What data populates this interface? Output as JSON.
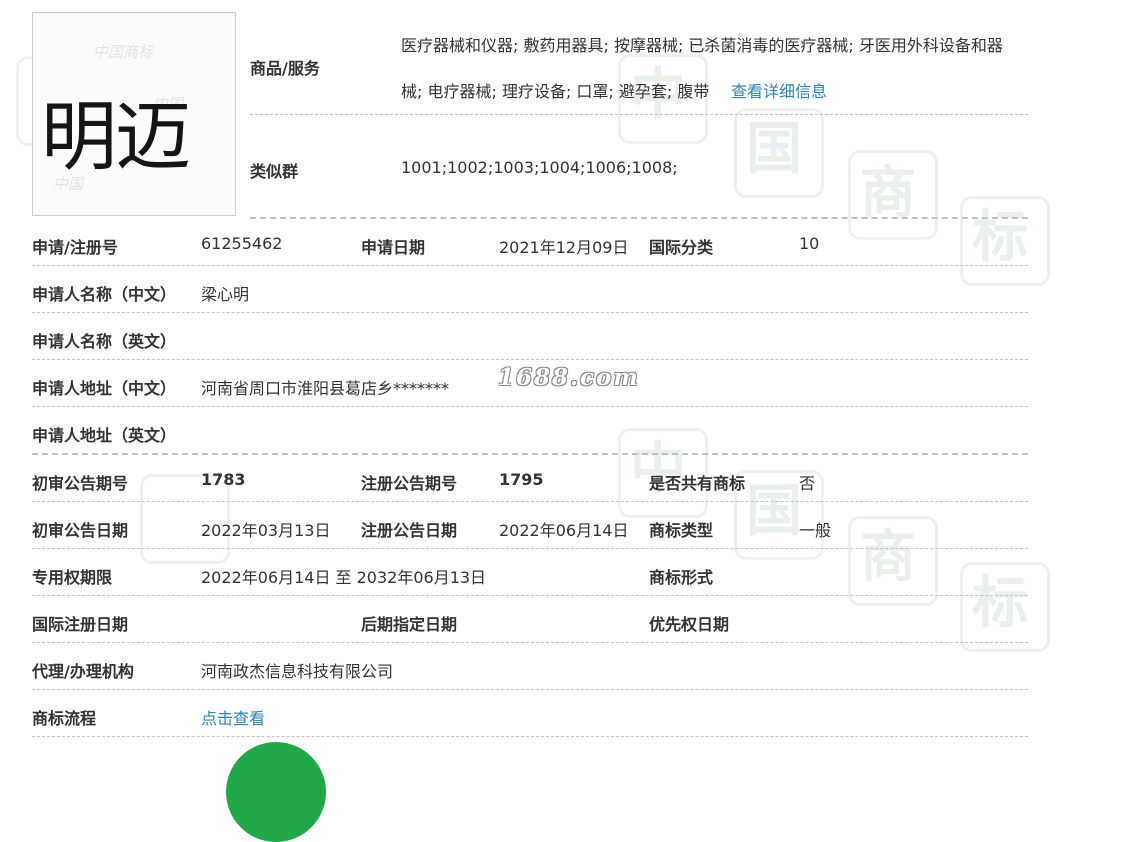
{
  "colors": {
    "link": "#2f86b3",
    "label": "#333333",
    "divider": "#c4c4c4",
    "watermark": "#e9efe9",
    "logo_button": "#21a849"
  },
  "watermark": {
    "site": "1688.com",
    "chars": [
      "中",
      "国",
      "商",
      "标"
    ]
  },
  "mark": {
    "text": "明迈",
    "background_lettering": [
      "中国商标",
      "中国",
      "中国"
    ]
  },
  "goods": {
    "label": "商品/服务",
    "line1": "医疗器械和仪器; 敷药用器具; 按摩器械; 已杀菌消毒的医疗器械; 牙医用外科设备和器",
    "line2": "械; 电疗器械; 理疗设备; 口罩; 避孕套; 腹带",
    "detail_link": "查看详细信息"
  },
  "similar_group": {
    "label": "类似群",
    "value": "1001;1002;1003;1004;1006;1008;"
  },
  "fields": {
    "reg_no_label": "申请/注册号",
    "reg_no": "61255462",
    "apply_date_label": "申请日期",
    "apply_date": "2021年12月09日",
    "intl_class_label": "国际分类",
    "intl_class": "10",
    "applicant_cn_label": "申请人名称（中文）",
    "applicant_cn": "梁心明",
    "applicant_en_label": "申请人名称（英文）",
    "applicant_en": "",
    "address_cn_label": "申请人地址（中文）",
    "address_cn": "河南省周口市淮阳县葛店乡*******",
    "address_en_label": "申请人地址（英文）",
    "address_en": "",
    "prelim_no_label": "初审公告期号",
    "prelim_no": "1783",
    "reg_notice_no_label": "注册公告期号",
    "reg_notice_no": "1795",
    "shared_label": "是否共有商标",
    "shared": "否",
    "prelim_date_label": "初审公告日期",
    "prelim_date": "2022年03月13日",
    "reg_notice_date_label": "注册公告日期",
    "reg_notice_date": "2022年06月14日",
    "mark_type_label": "商标类型",
    "mark_type": "一般",
    "term_label": "专用权期限",
    "term": "2022年06月14日 至 2032年06月13日",
    "mark_form_label": "商标形式",
    "mark_form": "",
    "intl_reg_date_label": "国际注册日期",
    "intl_reg_date": "",
    "later_date_label": "后期指定日期",
    "later_date": "",
    "priority_date_label": "优先权日期",
    "priority_date": "",
    "agent_label": "代理/办理机构",
    "agent": "河南政杰信息科技有限公司",
    "process_label": "商标流程",
    "process_link": "点击查看"
  }
}
